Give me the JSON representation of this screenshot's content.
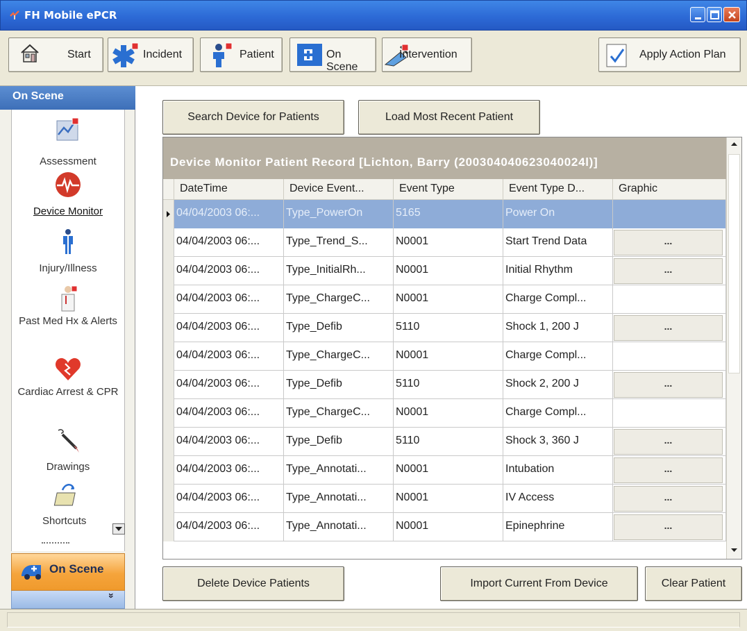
{
  "window": {
    "title": "FH Mobile ePCR"
  },
  "toolbar": {
    "start": "Start",
    "incident": "Incident",
    "patient": "Patient",
    "on_scene": "On Scene",
    "intervention": "Intervention",
    "apply_action_plan": "Apply Action Plan"
  },
  "sidebar": {
    "header": "On Scene",
    "items": [
      {
        "label": "Assessment",
        "icon": "assessment-icon"
      },
      {
        "label": "Device Monitor",
        "icon": "heart-monitor-icon",
        "active": true
      },
      {
        "label": "Injury/Illness",
        "icon": "body-icon"
      },
      {
        "label": "Past Med Hx & Alerts",
        "icon": "doctor-icon"
      },
      {
        "label": "Cardiac Arrest & CPR",
        "icon": "heart-icon"
      },
      {
        "label": "Drawings",
        "icon": "pen-icon"
      },
      {
        "label": "Shortcuts",
        "icon": "shortcuts-icon"
      }
    ],
    "nav_label": "On Scene",
    "more_chevron": "»"
  },
  "actions": {
    "search_device": "Search Device for Patients",
    "load_recent": "Load Most Recent Patient",
    "delete_device_patients": "Delete Device Patients",
    "import_current": "Import Current From Device",
    "clear_patient": "Clear Patient"
  },
  "grid": {
    "caption": "Device Monitor Patient Record [Lichton, Barry (200304040623040024l)]",
    "columns": [
      "DateTime",
      "Device Event...",
      "Event Type",
      "Event Type D...",
      "Graphic"
    ],
    "graphic_button": "...",
    "rows": [
      {
        "datetime": "04/04/2003 06:...",
        "device_event": "Type_PowerOn",
        "event_type": "5165",
        "event_desc": "Power On",
        "graphic": false,
        "selected": true
      },
      {
        "datetime": "04/04/2003 06:...",
        "device_event": "Type_Trend_S...",
        "event_type": "N0001",
        "event_desc": "Start Trend Data",
        "graphic": true
      },
      {
        "datetime": "04/04/2003 06:...",
        "device_event": "Type_InitialRh...",
        "event_type": "N0001",
        "event_desc": "Initial Rhythm",
        "graphic": true
      },
      {
        "datetime": "04/04/2003 06:...",
        "device_event": "Type_ChargeC...",
        "event_type": "N0001",
        "event_desc": "Charge Compl...",
        "graphic": false
      },
      {
        "datetime": "04/04/2003 06:...",
        "device_event": "Type_Defib",
        "event_type": "5110",
        "event_desc": "Shock 1, 200 J",
        "graphic": true
      },
      {
        "datetime": "04/04/2003 06:...",
        "device_event": "Type_ChargeC...",
        "event_type": "N0001",
        "event_desc": "Charge Compl...",
        "graphic": false
      },
      {
        "datetime": "04/04/2003 06:...",
        "device_event": "Type_Defib",
        "event_type": "5110",
        "event_desc": "Shock 2, 200 J",
        "graphic": true
      },
      {
        "datetime": "04/04/2003 06:...",
        "device_event": "Type_ChargeC...",
        "event_type": "N0001",
        "event_desc": "Charge Compl...",
        "graphic": false
      },
      {
        "datetime": "04/04/2003 06:...",
        "device_event": "Type_Defib",
        "event_type": "5110",
        "event_desc": "Shock 3, 360 J",
        "graphic": true
      },
      {
        "datetime": "04/04/2003 06:...",
        "device_event": "Type_Annotati...",
        "event_type": "N0001",
        "event_desc": "Intubation",
        "graphic": true
      },
      {
        "datetime": "04/04/2003 06:...",
        "device_event": "Type_Annotati...",
        "event_type": "N0001",
        "event_desc": "IV Access",
        "graphic": true
      },
      {
        "datetime": "04/04/2003 06:...",
        "device_event": "Type_Annotati...",
        "event_type": "N0001",
        "event_desc": "Epinephrine",
        "graphic": true
      }
    ]
  },
  "colors": {
    "titlebar": "#2d6ad6",
    "selected_row": "#8eacd8",
    "grid_caption": "#b7b0a2",
    "nav_active": "#f5a43c"
  }
}
